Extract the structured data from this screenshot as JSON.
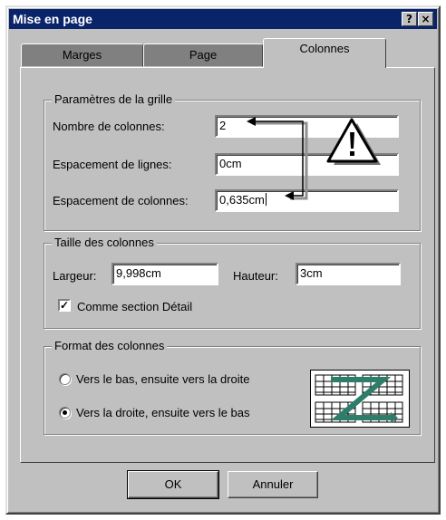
{
  "window": {
    "title": "Mise en page",
    "help_button": "?",
    "close_button": "×"
  },
  "tabs": [
    {
      "label": "Marges",
      "active": false
    },
    {
      "label": "Page",
      "active": false
    },
    {
      "label": "Colonnes",
      "active": true
    }
  ],
  "grid_settings": {
    "legend": "Paramètres de la grille",
    "number_of_columns": {
      "label": "Nombre de colonnes:",
      "value": "2"
    },
    "row_spacing": {
      "label": "Espacement de lignes:",
      "value": "0cm"
    },
    "column_spacing": {
      "label": "Espacement de colonnes:",
      "value": "0,635cm"
    }
  },
  "column_size": {
    "legend": "Taille des colonnes",
    "width": {
      "label": "Largeur:",
      "value": "9,998cm"
    },
    "height": {
      "label": "Hauteur:",
      "value": "3cm"
    },
    "same_as_detail": {
      "label": "Comme section Détail",
      "checked": true
    }
  },
  "column_layout": {
    "legend": "Format des colonnes",
    "options": [
      {
        "label": "Vers le bas, ensuite vers la droite",
        "selected": false
      },
      {
        "label": "Vers la droite, ensuite vers le bas",
        "selected": true
      }
    ]
  },
  "buttons": {
    "ok": "OK",
    "cancel": "Annuler"
  },
  "icons": {
    "warning": "warning-triangle-icon",
    "layout_preview": "z-order-preview-icon"
  },
  "colors": {
    "titlebar": "#0a246a",
    "face": "#c0c0c0",
    "preview_arrow": "#2e7d6b"
  }
}
